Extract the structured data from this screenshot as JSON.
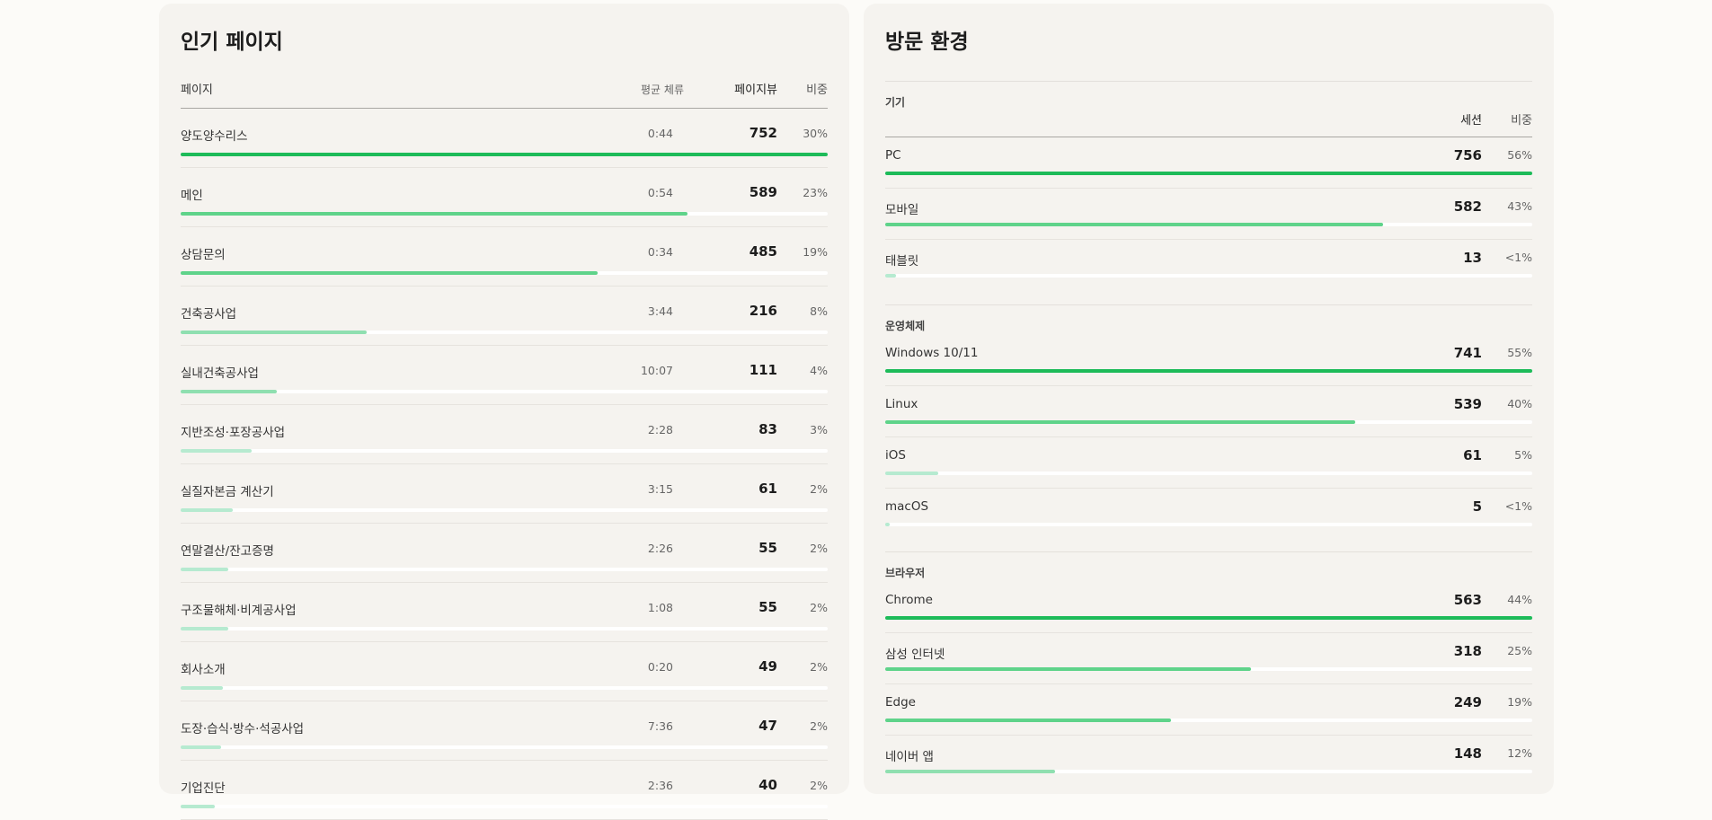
{
  "popular": {
    "title": "인기 페이지",
    "headers": {
      "page": "페이지",
      "stay": "평균 체류",
      "views": "페이지뷰",
      "share": "비중"
    },
    "rows": [
      {
        "name": "양도양수리스",
        "stay": "0:44",
        "views": "752",
        "share": "30%",
        "level": 1.0
      },
      {
        "name": "메인",
        "stay": "0:54",
        "views": "589",
        "share": "23%",
        "level": 0.783
      },
      {
        "name": "상담문의",
        "stay": "0:34",
        "views": "485",
        "share": "19%",
        "level": 0.645
      },
      {
        "name": "건축공사업",
        "stay": "3:44",
        "views": "216",
        "share": "8%",
        "level": 0.287
      },
      {
        "name": "실내건축공사업",
        "stay": "10:07",
        "views": "111",
        "share": "4%",
        "level": 0.148
      },
      {
        "name": "지반조성·포장공사업",
        "stay": "2:28",
        "views": "83",
        "share": "3%",
        "level": 0.11
      },
      {
        "name": "실질자본금 계산기",
        "stay": "3:15",
        "views": "61",
        "share": "2%",
        "level": 0.081
      },
      {
        "name": "연말결산/잔고증명",
        "stay": "2:26",
        "views": "55",
        "share": "2%",
        "level": 0.073
      },
      {
        "name": "구조물해체·비계공사업",
        "stay": "1:08",
        "views": "55",
        "share": "2%",
        "level": 0.073
      },
      {
        "name": "회사소개",
        "stay": "0:20",
        "views": "49",
        "share": "2%",
        "level": 0.065
      },
      {
        "name": "도장·습식·방수·석공사업",
        "stay": "7:36",
        "views": "47",
        "share": "2%",
        "level": 0.062
      },
      {
        "name": "기업진단",
        "stay": "2:36",
        "views": "40",
        "share": "2%",
        "level": 0.053
      }
    ]
  },
  "environment": {
    "title": "방문 환경",
    "headers": {
      "sessions": "세션",
      "share": "비중"
    },
    "device": {
      "label": "기기",
      "rows": [
        {
          "name": "PC",
          "views": "756",
          "share": "56%",
          "level": 1.0
        },
        {
          "name": "모바일",
          "views": "582",
          "share": "43%",
          "level": 0.77
        },
        {
          "name": "태블릿",
          "views": "13",
          "share": "<1%",
          "level": 0.017
        }
      ]
    },
    "os": {
      "label": "운영체제",
      "rows": [
        {
          "name": "Windows 10/11",
          "views": "741",
          "share": "55%",
          "level": 1.0
        },
        {
          "name": "Linux",
          "views": "539",
          "share": "40%",
          "level": 0.727
        },
        {
          "name": "iOS",
          "views": "61",
          "share": "5%",
          "level": 0.082
        },
        {
          "name": "macOS",
          "views": "5",
          "share": "<1%",
          "level": 0.007
        }
      ]
    },
    "browser": {
      "label": "브라우저",
      "rows": [
        {
          "name": "Chrome",
          "views": "563",
          "share": "44%",
          "level": 1.0
        },
        {
          "name": "삼성 인터넷",
          "views": "318",
          "share": "25%",
          "level": 0.565
        },
        {
          "name": "Edge",
          "views": "249",
          "share": "19%",
          "level": 0.442
        },
        {
          "name": "네이버 앱",
          "views": "148",
          "share": "12%",
          "level": 0.263
        }
      ]
    }
  },
  "colors": {
    "strong": "#1dbb59",
    "mid": "#5fd38a",
    "light": "#8fdfb0",
    "pale": "#b6ead0",
    "track": "#ffffff"
  }
}
